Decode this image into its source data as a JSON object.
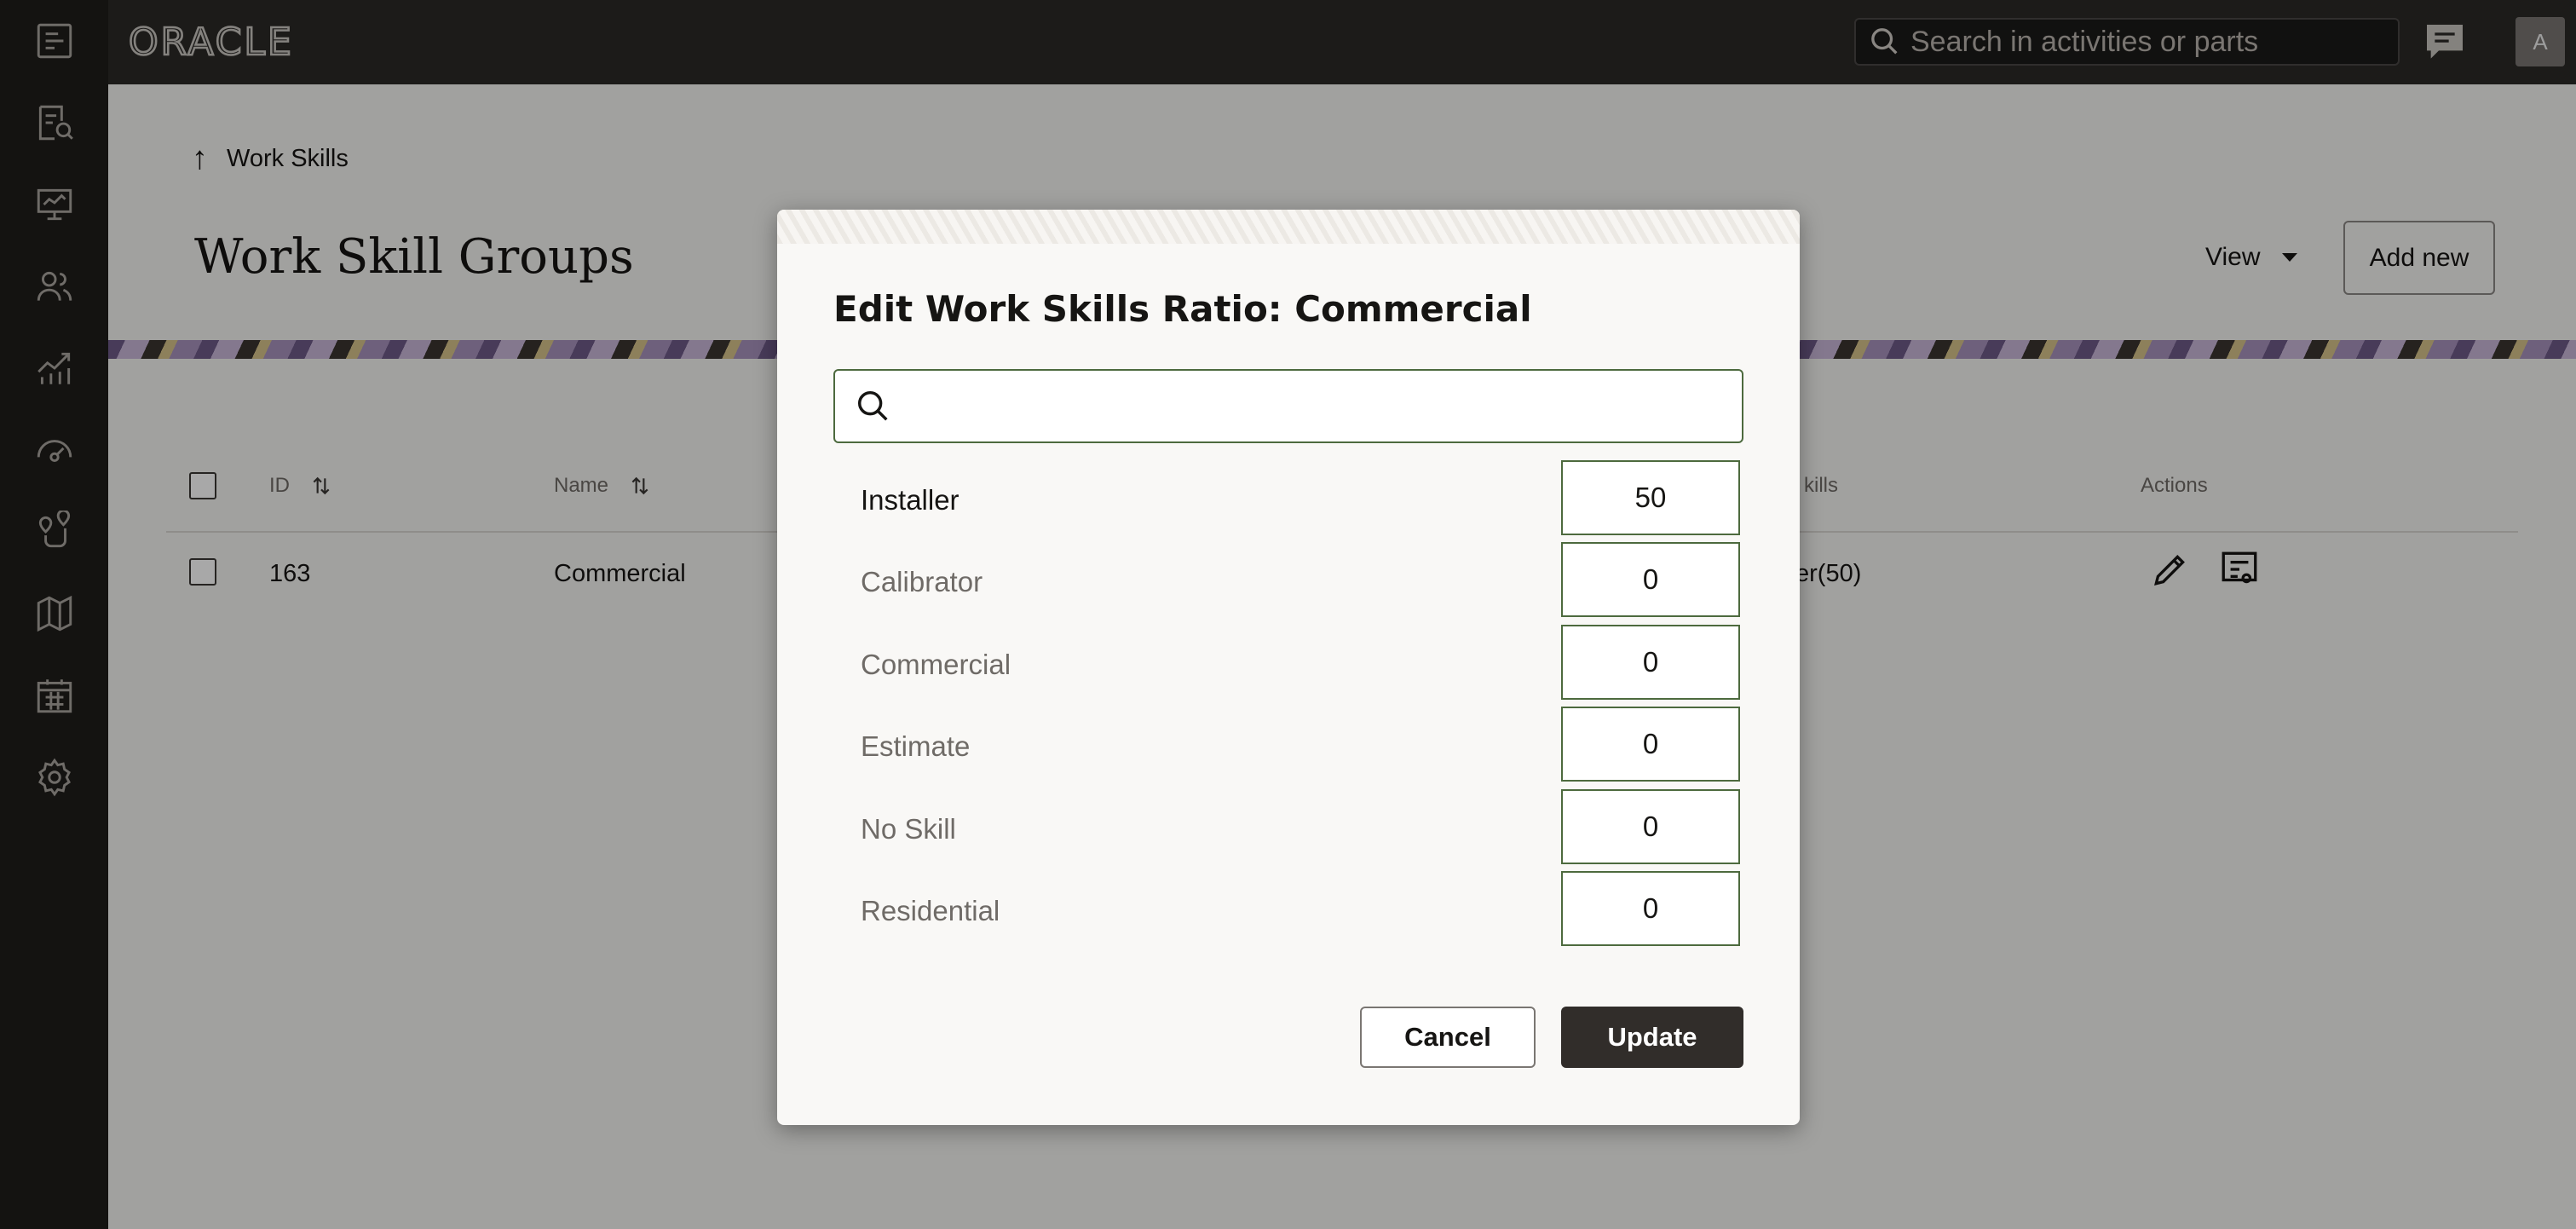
{
  "app": {
    "brand": "ORACLE"
  },
  "search": {
    "placeholder": "Search in activities or parts"
  },
  "user": {
    "initial": "A"
  },
  "nav_rail": [
    "dispatch-console-icon",
    "activity-search-icon",
    "dashboard-icon",
    "resources-icon",
    "reports-icon",
    "performance-icon",
    "routing-icon",
    "map-icon",
    "calendar-icon",
    "settings-icon"
  ],
  "breadcrumb": {
    "label": "Work Skills"
  },
  "page": {
    "title": "Work Skill Groups",
    "view_label": "View",
    "add_new_label": "Add new"
  },
  "table": {
    "columns": {
      "id": "ID",
      "name": "Name",
      "skills": "kills",
      "actions": "Actions"
    },
    "rows": [
      {
        "id": "163",
        "name": "Commercial",
        "skills": "er(50)"
      }
    ]
  },
  "dialog": {
    "title": "Edit Work Skills Ratio: Commercial",
    "search_value": "",
    "skills": [
      {
        "name": "Installer",
        "value": "50",
        "active": true
      },
      {
        "name": "Calibrator",
        "value": "0",
        "active": false
      },
      {
        "name": "Commercial",
        "value": "0",
        "active": false
      },
      {
        "name": "Estimate",
        "value": "0",
        "active": false
      },
      {
        "name": "No Skill",
        "value": "0",
        "active": false
      },
      {
        "name": "Residential",
        "value": "0",
        "active": false
      }
    ],
    "cancel_label": "Cancel",
    "update_label": "Update"
  },
  "colors": {
    "topbar": "#2b2927",
    "rail": "#1f1d1b",
    "primary_button": "#312d2a",
    "field_border": "#4d6a3e"
  }
}
